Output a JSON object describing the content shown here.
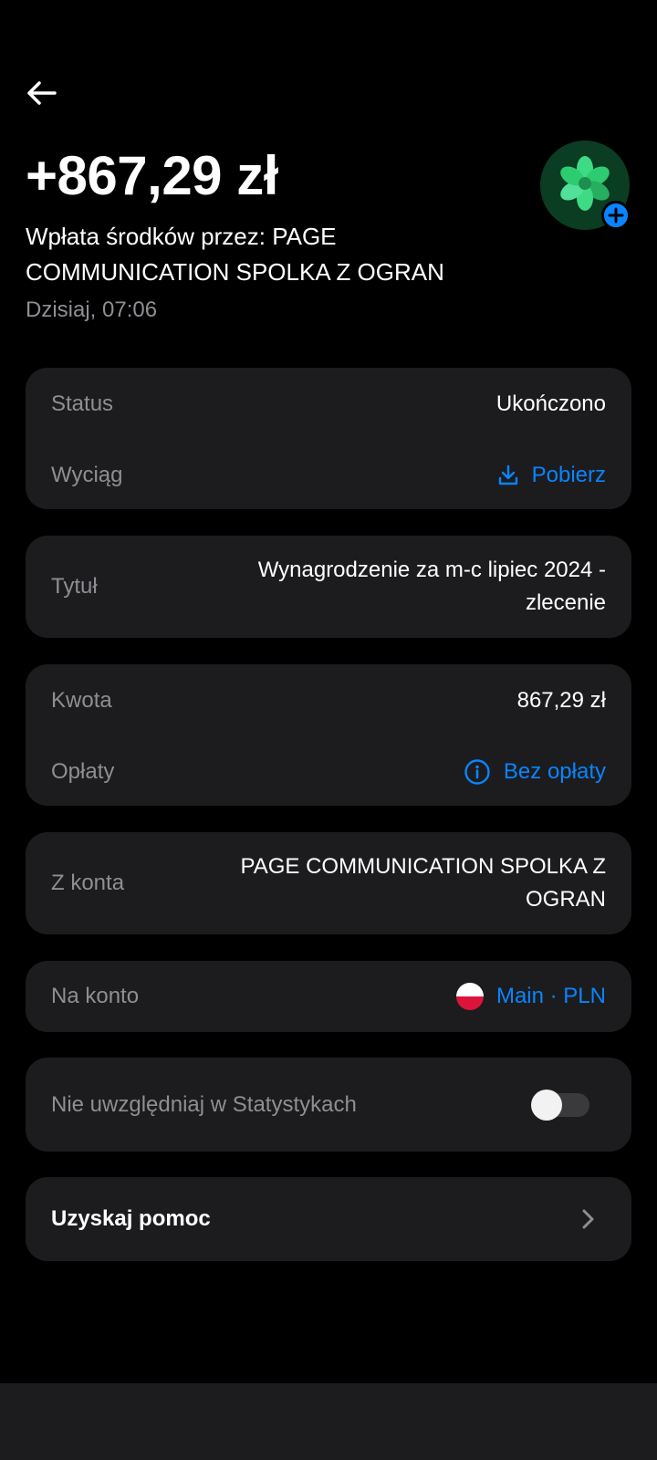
{
  "header": {
    "amount": "+867,29 zł",
    "description": "Wpłata środków przez:  PAGE COMMUNICATION  SPOLKA Z OGRAN",
    "date": "Dzisiaj, 07:06"
  },
  "status_card": {
    "status_label": "Status",
    "status_value": "Ukończono",
    "statement_label": "Wyciąg",
    "statement_action": "Pobierz"
  },
  "title_card": {
    "label": "Tytuł",
    "value": "Wynagrodzenie za m-c lipiec 2024 -  zlecenie"
  },
  "amount_card": {
    "amount_label": "Kwota",
    "amount_value": "867,29 zł",
    "fees_label": "Opłaty",
    "fees_value": "Bez opłaty"
  },
  "from_card": {
    "label": "Z konta",
    "value": "PAGE COMMUNICATION  SPOLKA Z OGRAN"
  },
  "to_card": {
    "label": "Na konto",
    "value": "Main · PLN"
  },
  "stats_card": {
    "label": "Nie uwzględniaj w Statystykach",
    "toggle_on": false
  },
  "help_card": {
    "label": "Uzyskaj pomoc"
  },
  "colors": {
    "accent": "#0a84ff",
    "card": "#1c1c1e",
    "label": "#8e8e93",
    "avatar_green": "#2ecc71"
  },
  "icons": [
    "back-arrow-icon",
    "download-icon",
    "info-icon",
    "poland-flag-icon",
    "chevron-right-icon",
    "plus-icon",
    "flower-icon"
  ]
}
